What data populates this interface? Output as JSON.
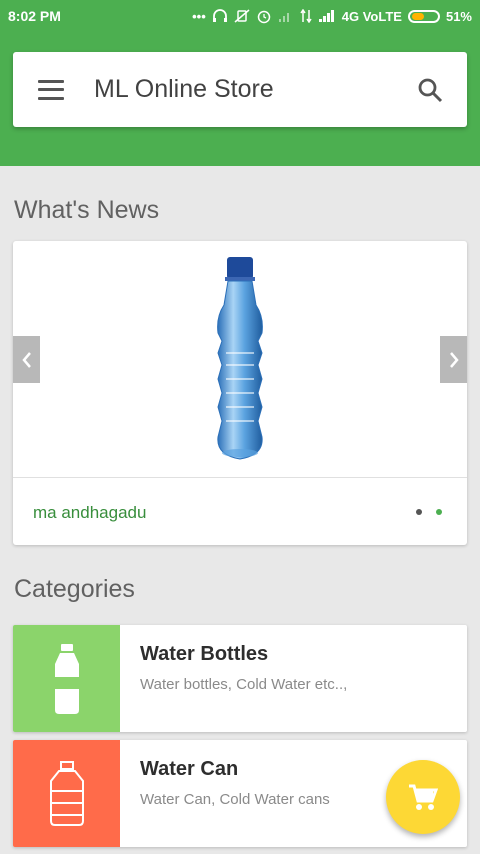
{
  "status_bar": {
    "time": "8:02 PM",
    "icons": [
      "more-dots-icon",
      "headphones-icon",
      "vibrate-off-icon",
      "alarm-icon",
      "no-signal-icon",
      "data-arrows-icon",
      "signal-bars-icon"
    ],
    "network": "4G VoLTE",
    "battery": "51%",
    "battery_level": 0.51
  },
  "app_bar": {
    "title": "ML Online Store",
    "menu_icon": "hamburger-menu-icon",
    "search_icon": "search-icon",
    "accent_color": "#4caf50"
  },
  "news": {
    "heading": "What's News",
    "caption": "ma andhagadu",
    "image_icon": "water-bottle-image",
    "prev_icon": "chevron-left-icon",
    "next_icon": "chevron-right-icon",
    "page_count": 2,
    "active_page": 2
  },
  "categories": {
    "heading": "Categories",
    "items": [
      {
        "name": "Water Bottles",
        "description": "Water bottles, Cold Water etc..,",
        "color": "#8bd46b",
        "icon": "water-bottle-icon"
      },
      {
        "name": "Water Can",
        "description": "Water Can, Cold Water cans",
        "color": "#ff6b4a",
        "icon": "water-can-icon"
      }
    ]
  },
  "fab": {
    "icon": "cart-icon",
    "color": "#fdd835"
  }
}
